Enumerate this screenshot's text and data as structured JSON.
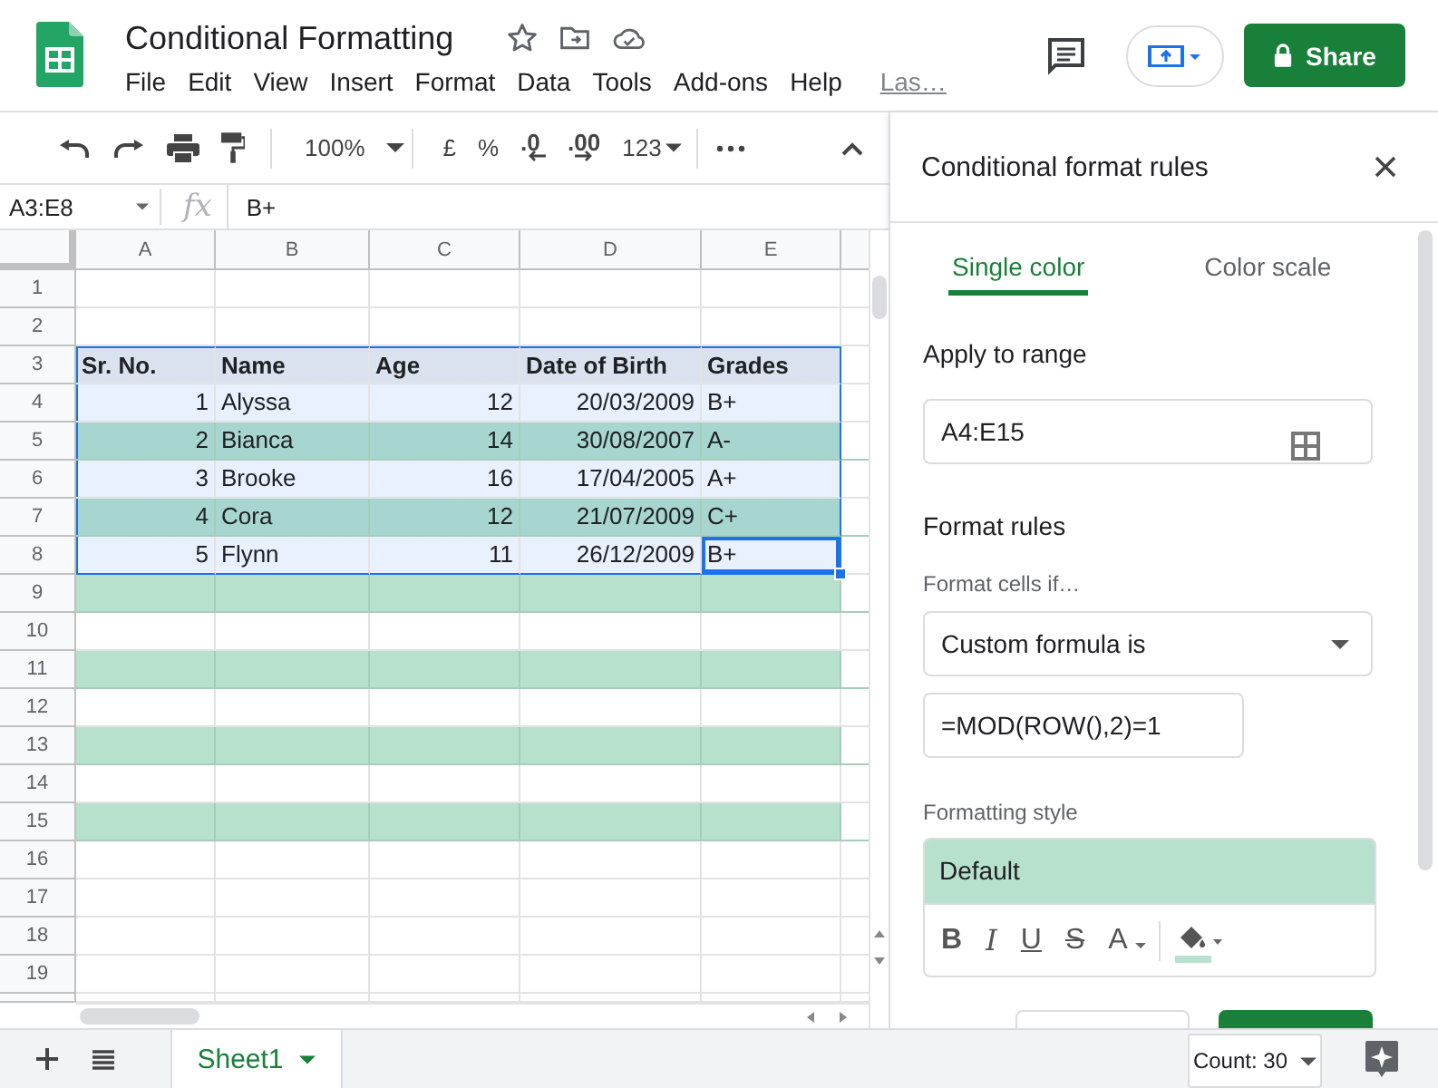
{
  "document": {
    "title": "Conditional Formatting",
    "menus": [
      "File",
      "Edit",
      "View",
      "Insert",
      "Format",
      "Data",
      "Tools",
      "Add-ons",
      "Help"
    ],
    "last_edit": "Las…",
    "share_label": "Share"
  },
  "toolbar": {
    "zoom": "100%",
    "items": [
      {
        "kind": "text",
        "label": "£"
      },
      {
        "kind": "text",
        "label": "%"
      },
      {
        "kind": "decrease",
        "label": ".0"
      },
      {
        "kind": "increase",
        "label": ".00"
      },
      {
        "kind": "dropdown",
        "label": "123"
      }
    ]
  },
  "formula_bar": {
    "name_box": "A3:E8",
    "fx": "fx",
    "value": "B+"
  },
  "sheet": {
    "columns": [
      "A",
      "B",
      "C",
      "D",
      "E"
    ],
    "rows": [
      {
        "number": "1",
        "kind": "plain"
      },
      {
        "number": "2",
        "kind": "plain"
      },
      {
        "number": "3",
        "kind": "header",
        "cells": [
          {
            "text": "Sr. No.",
            "kind": "text",
            "in_range": true,
            "active": false
          },
          {
            "text": "Name",
            "kind": "text",
            "in_range": true,
            "active": false
          },
          {
            "text": "Age",
            "kind": "text",
            "in_range": true,
            "active": false
          },
          {
            "text": "Date of Birth",
            "kind": "text",
            "in_range": true,
            "active": false
          },
          {
            "text": "Grades",
            "kind": "text",
            "in_range": true,
            "active": false
          }
        ]
      },
      {
        "number": "4",
        "kind": "plain",
        "cells": [
          {
            "text": "1",
            "kind": "number",
            "in_range": true,
            "active": false
          },
          {
            "text": "Alyssa",
            "kind": "text",
            "in_range": true,
            "active": false
          },
          {
            "text": "12",
            "kind": "number",
            "in_range": true,
            "active": false
          },
          {
            "text": "20/03/2009",
            "kind": "number",
            "in_range": true,
            "active": false
          },
          {
            "text": "B+",
            "kind": "text",
            "in_range": true,
            "active": false
          }
        ]
      },
      {
        "number": "5",
        "kind": "green",
        "cells": [
          {
            "text": "2",
            "kind": "number",
            "in_range": true,
            "active": false
          },
          {
            "text": "Bianca",
            "kind": "text",
            "in_range": true,
            "active": false
          },
          {
            "text": "14",
            "kind": "number",
            "in_range": true,
            "active": false
          },
          {
            "text": "30/08/2007",
            "kind": "number",
            "in_range": true,
            "active": false
          },
          {
            "text": "A-",
            "kind": "text",
            "in_range": true,
            "active": false
          }
        ]
      },
      {
        "number": "6",
        "kind": "plain",
        "cells": [
          {
            "text": "3",
            "kind": "number",
            "in_range": true,
            "active": false
          },
          {
            "text": "Brooke",
            "kind": "text",
            "in_range": true,
            "active": false
          },
          {
            "text": "16",
            "kind": "number",
            "in_range": true,
            "active": false
          },
          {
            "text": "17/04/2005",
            "kind": "number",
            "in_range": true,
            "active": false
          },
          {
            "text": "A+",
            "kind": "text",
            "in_range": true,
            "active": false
          }
        ]
      },
      {
        "number": "7",
        "kind": "green",
        "cells": [
          {
            "text": "4",
            "kind": "number",
            "in_range": true,
            "active": false
          },
          {
            "text": "Cora",
            "kind": "text",
            "in_range": true,
            "active": false
          },
          {
            "text": "12",
            "kind": "number",
            "in_range": true,
            "active": false
          },
          {
            "text": "21/07/2009",
            "kind": "number",
            "in_range": true,
            "active": false
          },
          {
            "text": "C+",
            "kind": "text",
            "in_range": true,
            "active": false
          }
        ]
      },
      {
        "number": "8",
        "kind": "plain",
        "cells": [
          {
            "text": "5",
            "kind": "number",
            "in_range": true,
            "active": false
          },
          {
            "text": "Flynn",
            "kind": "text",
            "in_range": true,
            "active": false
          },
          {
            "text": "11",
            "kind": "number",
            "in_range": true,
            "active": false
          },
          {
            "text": "26/12/2009",
            "kind": "number",
            "in_range": true,
            "active": false
          },
          {
            "text": "B+",
            "kind": "text",
            "in_range": true,
            "active": true
          }
        ]
      },
      {
        "number": "9",
        "kind": "green"
      },
      {
        "number": "10",
        "kind": "plain"
      },
      {
        "number": "11",
        "kind": "green"
      },
      {
        "number": "12",
        "kind": "plain"
      },
      {
        "number": "13",
        "kind": "green"
      },
      {
        "number": "14",
        "kind": "plain"
      },
      {
        "number": "15",
        "kind": "green"
      },
      {
        "number": "16",
        "kind": "plain"
      },
      {
        "number": "17",
        "kind": "plain"
      },
      {
        "number": "18",
        "kind": "plain"
      },
      {
        "number": "19",
        "kind": "plain"
      }
    ]
  },
  "panel": {
    "title": "Conditional format rules",
    "tabs": [
      {
        "label": "Single color",
        "selected": true
      },
      {
        "label": "Color scale",
        "selected": false
      }
    ],
    "range_heading": "Apply to range",
    "range": "A4:E15",
    "rules_heading": "Format rules",
    "condition_label": "Format cells if…",
    "condition": "Custom formula is",
    "formula": "=MOD(ROW(),2)=1",
    "style_heading": "Formatting style",
    "preview": "Default",
    "style_tools": [
      {
        "kind": "bold",
        "label": "B"
      },
      {
        "kind": "italic",
        "label": "I"
      },
      {
        "kind": "underline",
        "label": "U"
      },
      {
        "kind": "strike",
        "label": "S"
      },
      {
        "kind": "color",
        "label": "A"
      }
    ]
  },
  "bottom_bar": {
    "sheets": [
      {
        "label": "Sheet1",
        "selected": true
      }
    ],
    "summary": "Count: 30"
  }
}
